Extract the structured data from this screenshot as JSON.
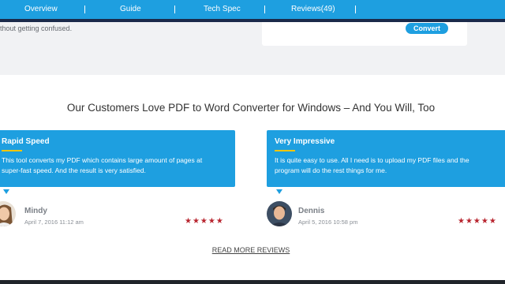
{
  "nav": {
    "items": [
      {
        "label": "Overview"
      },
      {
        "label": "Guide"
      },
      {
        "label": "Tech Spec"
      },
      {
        "label": "Reviews(49)"
      }
    ],
    "separator": "|"
  },
  "upper": {
    "text_fragment": "thout getting confused.",
    "convert_label": "Convert"
  },
  "headline": "Our Customers Love PDF to Word Converter for Windows – And You Will, Too",
  "reviews": [
    {
      "title": "Rapid Speed",
      "body": "This tool converts my PDF which contains large amount of pages at super-fast speed. And the result is very satisfied.",
      "name": "Mindy",
      "date": "April 7, 2016 11:12 am",
      "stars": "★★★★★",
      "rating": 5
    },
    {
      "title": "Very Impressive",
      "body": "It is quite easy to use. All I need is to upload my PDF files and the program will do the rest things for me.",
      "name": "Dennis",
      "date": "April 5, 2016 10:58 pm",
      "stars": "★★★★★",
      "rating": 5
    }
  ],
  "read_more_label": "READ MORE REVIEWS",
  "colors": {
    "accent": "#1e9fe0",
    "underline": "#f6c500",
    "stars": "#b8252f"
  }
}
